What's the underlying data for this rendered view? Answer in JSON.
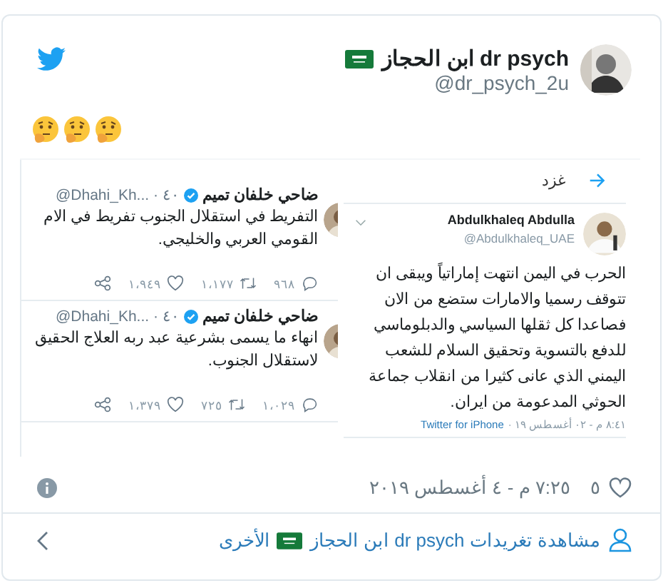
{
  "author": {
    "name": "dr psych ابن الحجاز",
    "handle": "@dr_psych_2u"
  },
  "embedded_screenshot": {
    "left_tweets": [
      {
        "name": "ضاحي خلفان تميم",
        "verified": true,
        "meta": "@Dhahi_Kh... · ٤٠",
        "text": "التفريط في استقلال الجنوب تفريط في الام\nالقومي العربي والخليجي.",
        "replies": "٩٦٨",
        "retweets": "١،١٧٧",
        "likes": "١،٩٤٩"
      },
      {
        "name": "ضاحي خلفان تميم",
        "verified": true,
        "meta": "@Dhahi_Kh... · ٤٠",
        "text": "انهاء ما يسمى بشرعية عبد ربه العلاج الحقيق\nلاستقلال الجنوب.",
        "replies": "١،٠٢٩",
        "retweets": "٧٢٥",
        "likes": "١،٣٧٩"
      }
    ],
    "translate_link": "غزد",
    "quoted": {
      "name": "Abdulkhaleq Abdulla",
      "handle": "@Abdulkhaleq_UAE",
      "text": "الحرب في اليمن انتهت إماراتياً ويبقى ان\nتتوقف رسميا والامارات ستضع من الان\nفصاعدا كل ثقلها السياسي والدبلوماسي\nللدفع بالتسوية وتحقيق السلام للشعب\nاليمني الذي عانى كثيرا من انقلاب جماعة\nالحوثي المدعومة من ايران.",
      "source": "Twitter for iPhone",
      "date": "٨:٤١ م - ٠٢ أغسطس ١٩ ·"
    }
  },
  "likes": "٥",
  "timestamp": "٧:٢٥ م - ٤ أغسطس ٢٠١٩",
  "footer_link": {
    "prefix": "مشاهدة تغريدات",
    "name": "dr psych ابن الحجاز",
    "suffix": "الأخرى"
  }
}
